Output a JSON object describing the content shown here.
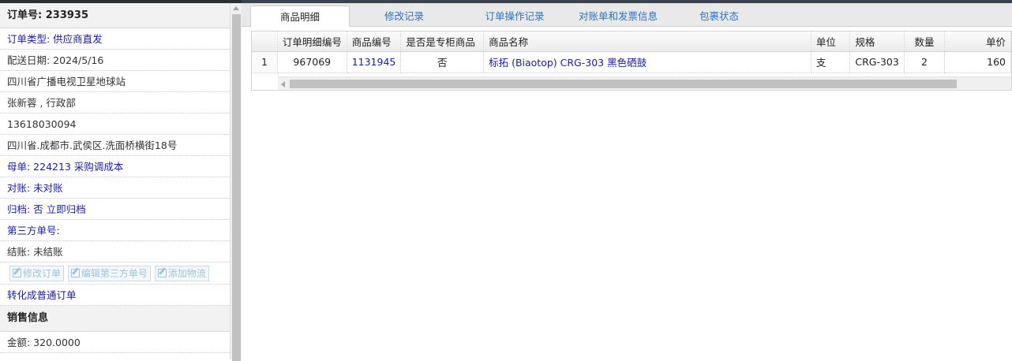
{
  "order": {
    "number_label": "订单号: 233935",
    "type_label": "订单类型: 供应商直发",
    "delivery_date": "配送日期: 2024/5/16",
    "customer": "四川省广播电视卫星地球站",
    "contact": "张新蓉 , 行政部",
    "phone": "13618030094",
    "address": "四川省.成都市.武侯区.洗面桥横街18号",
    "parent_order": "母单: 224213 采购调成本",
    "reconcile": "对账: 未对账",
    "archive_label": "归档: ",
    "archive_value": "否",
    "archive_link": "立即归档",
    "third_party_no": "第三方单号:",
    "settlement": "结账: 未结账",
    "buttons": {
      "edit_order": "修改订单",
      "edit_third_party": "编辑第三方单号",
      "add_logistics": "添加物流"
    },
    "convert_link": "转化成普通订单",
    "sales_header": "销售信息",
    "amount": "金额: 320.0000"
  },
  "tabs": [
    {
      "label": "商品明细",
      "active": true
    },
    {
      "label": "修改记录",
      "active": false
    },
    {
      "label": "订单操作记录",
      "active": false
    },
    {
      "label": "对账单和发票信息",
      "active": false
    },
    {
      "label": "包裹状态",
      "active": false
    }
  ],
  "grid": {
    "columns": [
      "",
      "订单明细编号",
      "商品编号",
      "是否是专柜商品",
      "商品名称",
      "单位",
      "规格",
      "数量",
      "单价"
    ],
    "rows": [
      {
        "row_no": "1",
        "detail_id": "967069",
        "product_id": "1131945",
        "is_counter": "否",
        "product_name": "标拓 (Biaotop) CRG-303 黑色硒鼓",
        "unit": "支",
        "spec": "CRG-303",
        "qty": "2",
        "price": "160"
      }
    ]
  },
  "colors": {
    "link": "#1a1aa6",
    "tab_link": "#2a72c0",
    "disabled_button": "#9fc3dc"
  }
}
